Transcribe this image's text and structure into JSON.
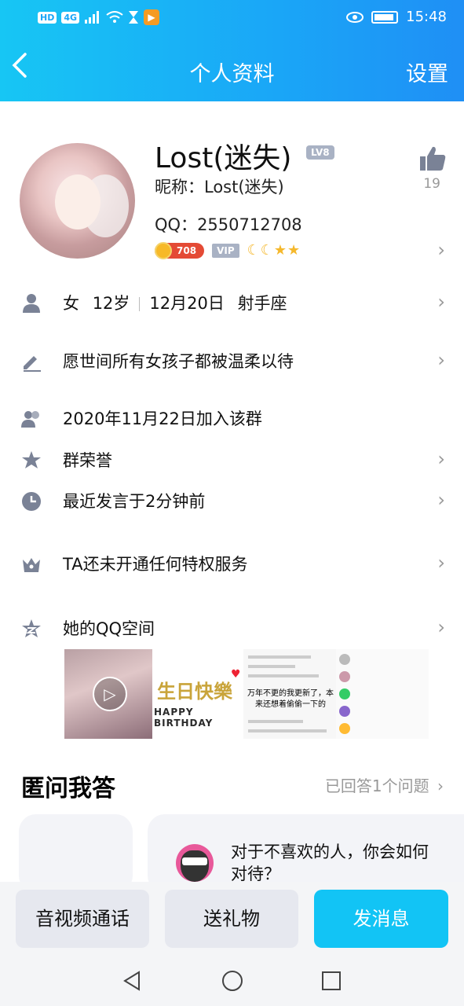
{
  "status_bar": {
    "left_chips": [
      "HD",
      "4G"
    ],
    "time": "15:48"
  },
  "navbar": {
    "back": "<",
    "title": "个人资料",
    "settings": "设置"
  },
  "profile": {
    "name": "Lost(迷失)",
    "level": "LV8",
    "nickname_label": "昵称：",
    "nickname": "Lost(迷失)",
    "qq_label": "QQ：",
    "qq_number": "2550712708",
    "sun_value": "708",
    "vip": "VIP",
    "like_count": "19"
  },
  "rows": {
    "basic": {
      "gender": "女",
      "age": "12岁",
      "birthday": "12月20日",
      "zodiac": "射手座"
    },
    "signature": "愿世间所有女孩子都被温柔以待",
    "joined": "2020年11月22日加入该群",
    "honor": "群荣誉",
    "last_speak": "最近发言于2分钟前",
    "privilege": "TA还未开通任何特权服务",
    "qzone": "她的QQ空间"
  },
  "gallery": {
    "birthday_cn": "生日快樂",
    "birthday_en": "HAPPY BIRTHDAY",
    "caption": "万年不更的我更新了，本来还想着偷偷一下的"
  },
  "qa": {
    "title": "匿问我答",
    "answered": "已回答1个问题",
    "question": "对于不喜欢的人，你会如何对待？"
  },
  "actions": {
    "call": "音视频通话",
    "gift": "送礼物",
    "message": "发消息"
  },
  "colors": {
    "header_start": "#17c6f4",
    "header_end": "#1f8ff5",
    "primary_button": "#12c4f5",
    "icon_gray": "#7a8296"
  }
}
